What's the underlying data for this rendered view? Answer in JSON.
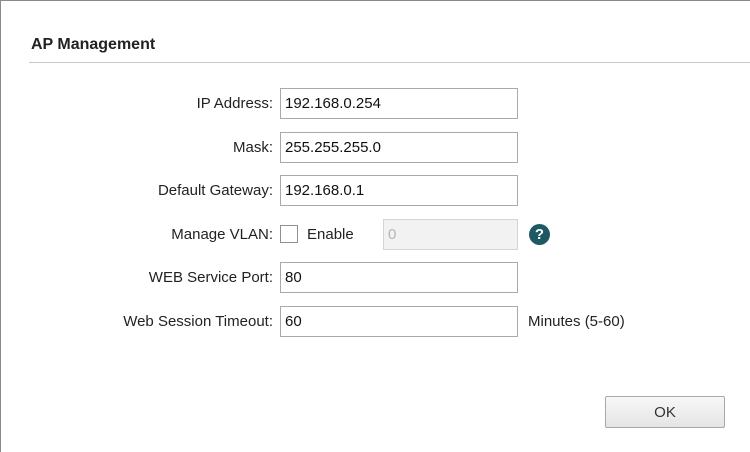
{
  "section": {
    "title": "AP Management"
  },
  "form": {
    "ip_address": {
      "label": "IP Address:",
      "value": "192.168.0.254"
    },
    "mask": {
      "label": "Mask:",
      "value": "255.255.255.0"
    },
    "default_gateway": {
      "label": "Default Gateway:",
      "value": "192.168.0.1"
    },
    "manage_vlan": {
      "label": "Manage VLAN:",
      "enable_label": "Enable",
      "enabled": false,
      "vlan_value": "0",
      "help_icon": "question-circle-icon"
    },
    "web_service_port": {
      "label": "WEB Service Port:",
      "value": "80"
    },
    "web_session_timeout": {
      "label": "Web Session Timeout:",
      "value": "60",
      "suffix": "Minutes (5-60)"
    }
  },
  "actions": {
    "ok_label": "OK"
  },
  "colors": {
    "help_icon": "#1e5963",
    "border": "#a9a9a9",
    "disabled_bg": "#f2f2f2"
  }
}
